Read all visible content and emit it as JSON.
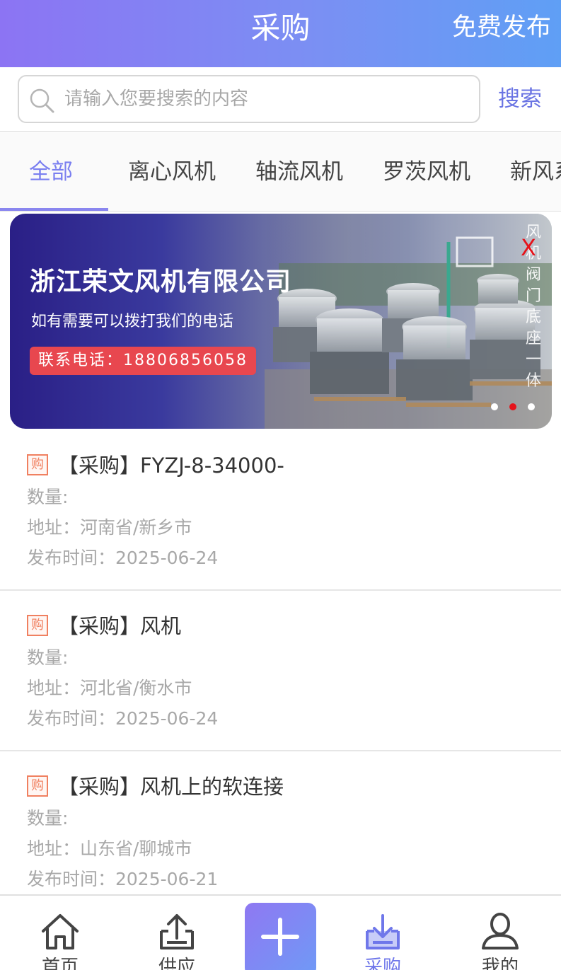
{
  "header": {
    "title": "采购",
    "action": "免费发布"
  },
  "search": {
    "placeholder": "请输入您要搜索的内容",
    "button": "搜索"
  },
  "tabs": [
    {
      "label": "全部",
      "active": true
    },
    {
      "label": "离心风机",
      "active": false
    },
    {
      "label": "轴流风机",
      "active": false
    },
    {
      "label": "罗茨风机",
      "active": false
    },
    {
      "label": "新风系",
      "active": false
    }
  ],
  "banner": {
    "company": "浙江荣文风机有限公司",
    "subtitle": "如有需要可以拨打我们的电话",
    "phone": "联系电话：18806856058",
    "close": "X",
    "vertical_text": "风机阀门底座一体",
    "slides": 3,
    "active_slide": 2
  },
  "badge_text": "购",
  "listings": [
    {
      "title": "【采购】FYZJ-8-34000-",
      "quantity": "数量:",
      "address": "地址：河南省/新乡市",
      "time": "发布时间：2025-06-24"
    },
    {
      "title": "【采购】风机",
      "quantity": "数量:",
      "address": "地址：河北省/衡水市",
      "time": "发布时间：2025-06-24"
    },
    {
      "title": "【采购】风机上的软连接",
      "quantity": "数量:",
      "address": "地址：山东省/聊城市",
      "time": "发布时间：2025-06-21"
    }
  ],
  "bottom_nav": [
    {
      "label": "首页",
      "icon": "home-icon",
      "active": false
    },
    {
      "label": "供应",
      "icon": "upload-icon",
      "active": false
    },
    {
      "label": "",
      "icon": "plus-icon",
      "active": false
    },
    {
      "label": "采购",
      "icon": "download-icon",
      "active": true
    },
    {
      "label": "我的",
      "icon": "user-icon",
      "active": false
    }
  ],
  "colors": {
    "accent": "#7a7ff0",
    "header_start": "#8c74f3",
    "header_end": "#5f9ff5",
    "badge": "#f08060",
    "close": "#e5131b"
  }
}
